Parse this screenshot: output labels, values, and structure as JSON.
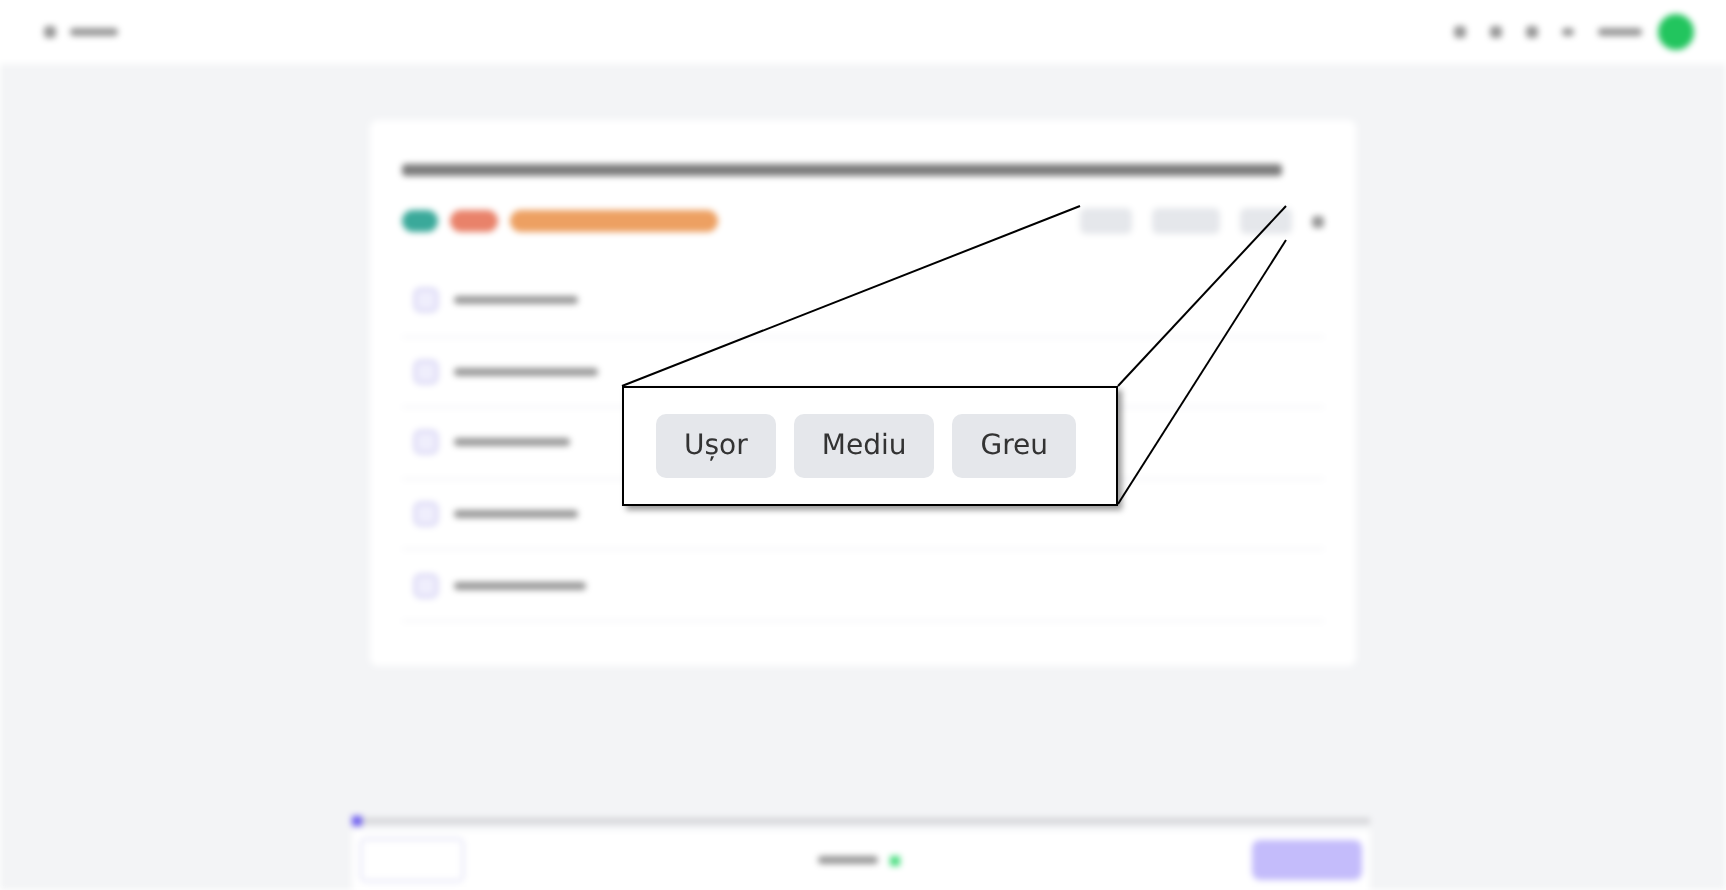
{
  "callout": {
    "buttons": [
      {
        "label": "Ușor"
      },
      {
        "label": "Mediu"
      },
      {
        "label": "Greu"
      }
    ]
  }
}
